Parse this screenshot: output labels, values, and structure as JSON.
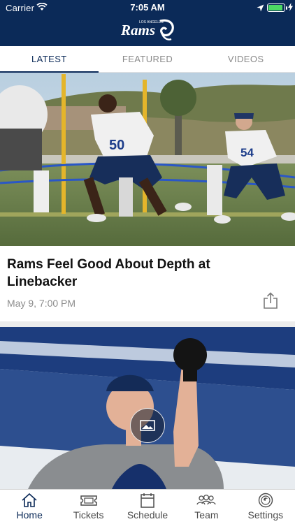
{
  "status_bar": {
    "carrier": "Carrier",
    "time": "7:05 AM"
  },
  "header": {
    "logo_text": "Rams",
    "logo_subtext": "LOS ANGELES"
  },
  "tabs": [
    {
      "label": "LATEST",
      "active": true
    },
    {
      "label": "FEATURED",
      "active": false
    },
    {
      "label": "VIDEOS",
      "active": false
    }
  ],
  "feed": {
    "articles": [
      {
        "headline": "Rams Feel Good About Depth at Linebacker",
        "date": "May 9, 7:00 PM",
        "jersey_numbers": [
          "50",
          "54"
        ]
      }
    ]
  },
  "tabbar": {
    "items": [
      {
        "label": "Home",
        "icon": "home-icon",
        "active": true
      },
      {
        "label": "Tickets",
        "icon": "ticket-icon",
        "active": false
      },
      {
        "label": "Schedule",
        "icon": "calendar-icon",
        "active": false
      },
      {
        "label": "Team",
        "icon": "team-icon",
        "active": false
      },
      {
        "label": "Settings",
        "icon": "settings-icon",
        "active": false
      }
    ]
  },
  "colors": {
    "brand_navy": "#0b2a58",
    "battery_green": "#4cd964",
    "tab_inactive": "#8a8a8a"
  }
}
